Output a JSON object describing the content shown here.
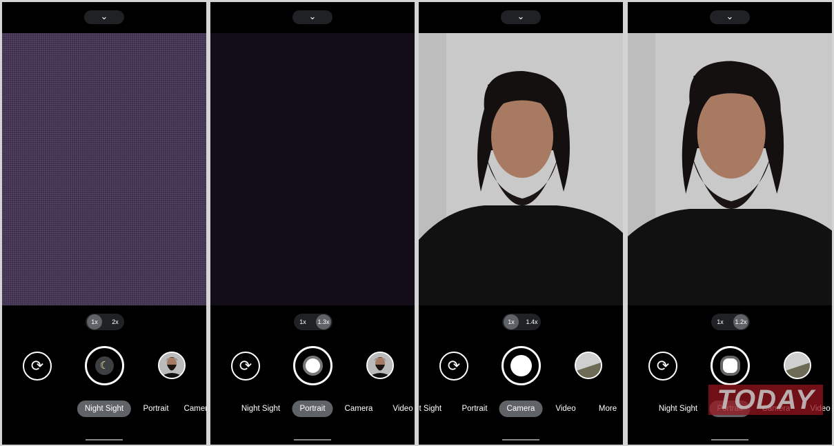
{
  "panels": [
    {
      "preview": "noise-purple",
      "zoom": [
        "1x",
        "2x"
      ],
      "zoom_active": 0,
      "shutter": "night-sight",
      "thumb": "portrait-photo",
      "modes": [
        "Night Sight",
        "Portrait",
        "Camera"
      ],
      "mode_active": 0
    },
    {
      "preview": "dark",
      "zoom": [
        "1x",
        "1.3x"
      ],
      "zoom_active": 1,
      "shutter": "portrait",
      "thumb": "portrait-photo",
      "modes": [
        "Night Sight",
        "Portrait",
        "Camera",
        "Video"
      ],
      "mode_active": 1
    },
    {
      "preview": "photo",
      "zoom": [
        "1x",
        "1.4x"
      ],
      "zoom_active": 0,
      "shutter": "camera",
      "thumb": "landscape-photo",
      "modes": [
        "Night Sight",
        "Portrait",
        "Camera",
        "Video",
        "More"
      ],
      "mode_active": 2
    },
    {
      "preview": "photo",
      "zoom": [
        "1x",
        "1.2x"
      ],
      "zoom_active": 1,
      "shutter": "portrait-capturing",
      "thumb": "landscape-photo",
      "modes": [
        "Night Sight",
        "Portrait",
        "Camera",
        "Video"
      ],
      "mode_active": 1
    }
  ],
  "icons": {
    "top": "chevron-down-icon",
    "flip": "switch-camera-icon",
    "night": "moon-icon"
  },
  "watermark": "TODAY"
}
